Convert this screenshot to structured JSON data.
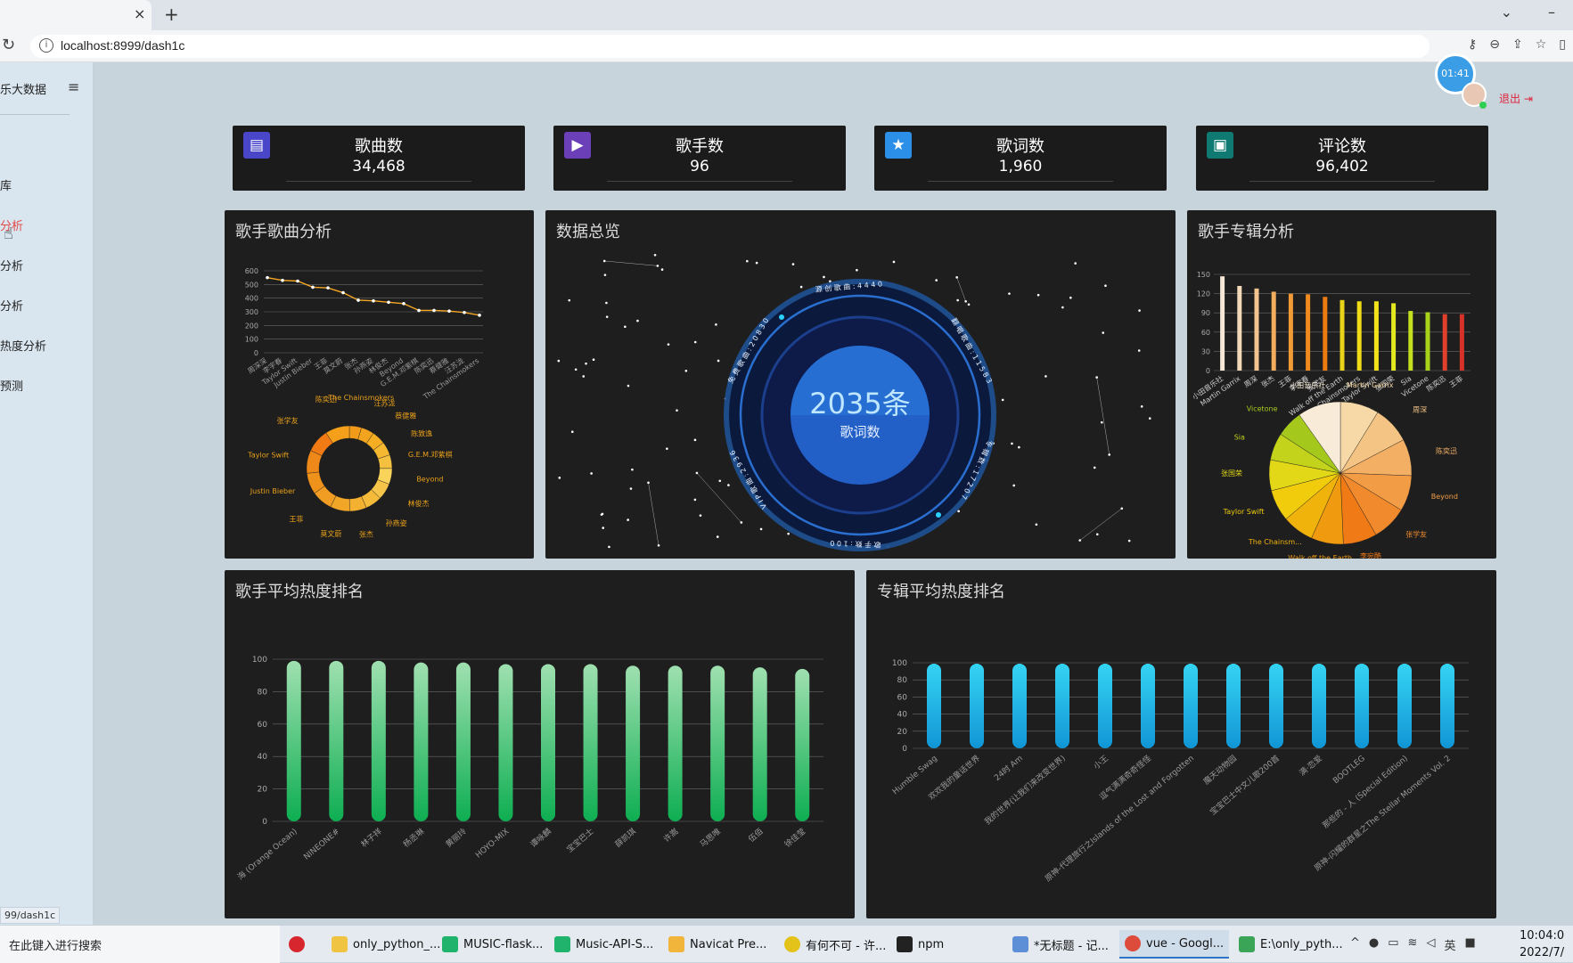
{
  "browser": {
    "tab_close": "×",
    "new_tab": "+",
    "url": "localhost:8999/dash1c",
    "status_url": "99/dash1c"
  },
  "sidebar": {
    "title": "乐大数据",
    "items": [
      {
        "label": "库"
      },
      {
        "label": "分析"
      },
      {
        "label": "分析"
      },
      {
        "label": "分析"
      },
      {
        "label": "热度分析"
      },
      {
        "label": "预测"
      }
    ]
  },
  "header": {
    "clock": "01:41",
    "logout": "退出"
  },
  "stats": [
    {
      "label": "歌曲数",
      "value": "34,468",
      "icon": "film-icon",
      "color": "#4a46c9"
    },
    {
      "label": "歌手数",
      "value": "96",
      "icon": "media-icon",
      "color": "#6a3fb8"
    },
    {
      "label": "歌词数",
      "value": "1,960",
      "icon": "star-icon",
      "color": "#2b8fe8"
    },
    {
      "label": "评论数",
      "value": "96,402",
      "icon": "contact-icon",
      "color": "#0f7a72"
    }
  ],
  "panels": {
    "singer_song": "歌手歌曲分析",
    "overview": "数据总览",
    "singer_album": "歌手专辑分析",
    "singer_heat": "歌手平均热度排名",
    "album_heat": "专辑平均热度排名"
  },
  "overview": {
    "center_value": "2035条",
    "center_label": "歌词数",
    "ring_labels": [
      "源 创 歌 曲 : 4 4 4 0",
      "翻 唱 歌 曲 : 1 1 5 8 3",
      "专 辑 数 : 1 7 2 0 7",
      "歌 手 数 : 1 0 0",
      "V I P 歌 曲 : 2 9 3 6",
      "免 费 歌 曲 : 2 0 8 3 0"
    ]
  },
  "chart_data": [
    {
      "type": "line",
      "title": "歌手歌曲分析",
      "ylim": [
        0,
        600
      ],
      "yticks": [
        "0",
        "100",
        "200",
        "300",
        "400",
        "500",
        "600"
      ],
      "categories": [
        "周深深",
        "李宇春",
        "Taylor Swift",
        "Justin Bieber",
        "王菲",
        "莫文蔚",
        "张杰",
        "孙燕姿",
        "林俊杰",
        "Beyond",
        "G.E.M.邓紫棋",
        "陈奕迅",
        "蔡健雅",
        "汪苏泷",
        "The Chainsmokers"
      ],
      "values": [
        550,
        530,
        525,
        480,
        475,
        440,
        385,
        380,
        370,
        360,
        310,
        310,
        305,
        295,
        275
      ],
      "color": "#f5a623"
    },
    {
      "type": "pie",
      "title": "歌手歌曲分析 (ring)",
      "labels": [
        "The Chainsmokers",
        "汪苏泷",
        "蔡健雅",
        "陈致逸",
        "G.E.M.邓紫棋",
        "Beyond",
        "林俊杰",
        "孙燕姿",
        "张杰",
        "莫文蔚",
        "王菲",
        "Justin Bieber",
        "Taylor Swift",
        "张学友",
        "陈奕迅"
      ],
      "values": [
        275,
        295,
        305,
        310,
        310,
        360,
        370,
        380,
        385,
        440,
        475,
        480,
        525,
        530,
        550
      ]
    },
    {
      "type": "bar",
      "title": "歌手专辑分析",
      "ylim": [
        0,
        150
      ],
      "yticks": [
        "0",
        "30",
        "60",
        "90",
        "120",
        "150"
      ],
      "categories": [
        "小田音乐社",
        "Martin Garrix",
        "周深",
        "张杰",
        "王菲",
        "李宇春",
        "张学友",
        "Walk off the Earth",
        "The Chainsmokers",
        "Taylor Swift",
        "张国荣",
        "Sia",
        "Vicetone",
        "陈奕迅",
        "王菲"
      ],
      "values": [
        147,
        132,
        128,
        123,
        120,
        119,
        115,
        110,
        108,
        108,
        105,
        93,
        91,
        88,
        88
      ],
      "colors": [
        "#f6e7d6",
        "#f4d9b8",
        "#f3c48e",
        "#f2ae5c",
        "#f29a36",
        "#f08a1e",
        "#ee7a12",
        "#e8d21a",
        "#f0dc16",
        "#f4e31a",
        "#e4e81e",
        "#c5e01c",
        "#a9d31a",
        "#e0402c",
        "#d6322a"
      ]
    },
    {
      "type": "pie",
      "title": "歌手专辑分析 (pie)",
      "labels": [
        "Martin Garrix",
        "周深",
        "陈奕迅",
        "Beyond",
        "张学友",
        "李宛酷",
        "Walk off the Earth",
        "The Chainsm...",
        "Taylor Swift",
        "张国荣",
        "Sia",
        "Vicetone",
        "小田音乐社"
      ],
      "values": [
        132,
        128,
        125,
        122,
        120,
        115,
        110,
        108,
        108,
        105,
        93,
        91,
        147
      ]
    },
    {
      "type": "bar",
      "title": "歌手平均热度排名",
      "ylim": [
        0,
        100
      ],
      "yticks": [
        "0",
        "20",
        "40",
        "60",
        "80",
        "100"
      ],
      "categories": [
        "海 (Orange Ocean)",
        "NINEONE#",
        "林子祥",
        "杨丞琳",
        "黄丽玲",
        "HOYO-MIX",
        "谭咏麟",
        "宝宝巴士",
        "薛凯琪",
        "许嵩",
        "马思唯",
        "伍佰",
        "徐佳莹"
      ],
      "values": [
        99,
        99,
        99,
        98,
        98,
        97,
        97,
        97,
        96,
        96,
        96,
        95,
        94
      ]
    },
    {
      "type": "bar",
      "title": "专辑平均热度排名",
      "ylim": [
        0,
        100
      ],
      "yticks": [
        "0",
        "20",
        "40",
        "60",
        "80",
        "100"
      ],
      "categories": [
        "Humble Swag",
        "欢欢我的童话世界",
        "24时 Am",
        "我的世界(让我们来改变世界)",
        "小王",
        "逗气满满奇奇怪怪",
        "原神-代理旅行之Islands of the Lost and Forgotten",
        "魔天动物园",
        "宝宝巴士中文儿歌200首",
        "满·恋爱",
        "BOOTLEG",
        "那些的 - 人 (Special Edition)",
        "原神-闪耀的群星之The Stellar Moments Vol. 2"
      ],
      "values": [
        99,
        99,
        99,
        99,
        99,
        99,
        99,
        99,
        99,
        99,
        99,
        99,
        99
      ]
    }
  ],
  "taskbar": {
    "search": "在此键入进行搜索",
    "apps": [
      {
        "label": "only_python_...",
        "color": "#f0c443"
      },
      {
        "label": "MUSIC-flask...",
        "color": "#1fb36b"
      },
      {
        "label": "Music-API-S...",
        "color": "#1fb36b"
      },
      {
        "label": "Navicat Pre...",
        "color": "#f0b53a"
      },
      {
        "label": "有何不可 - 许...",
        "color": "#e3c21a"
      },
      {
        "label": "npm",
        "color": "#222222"
      },
      {
        "label": "*无标题 - 记...",
        "color": "#5c8fd6"
      },
      {
        "label": "vue - Googl...",
        "color": "#dd4b3b"
      },
      {
        "label": "E:\\only_pyth...",
        "color": "#3aa457"
      }
    ],
    "time": "10:04:0",
    "date": "2022/7/"
  }
}
